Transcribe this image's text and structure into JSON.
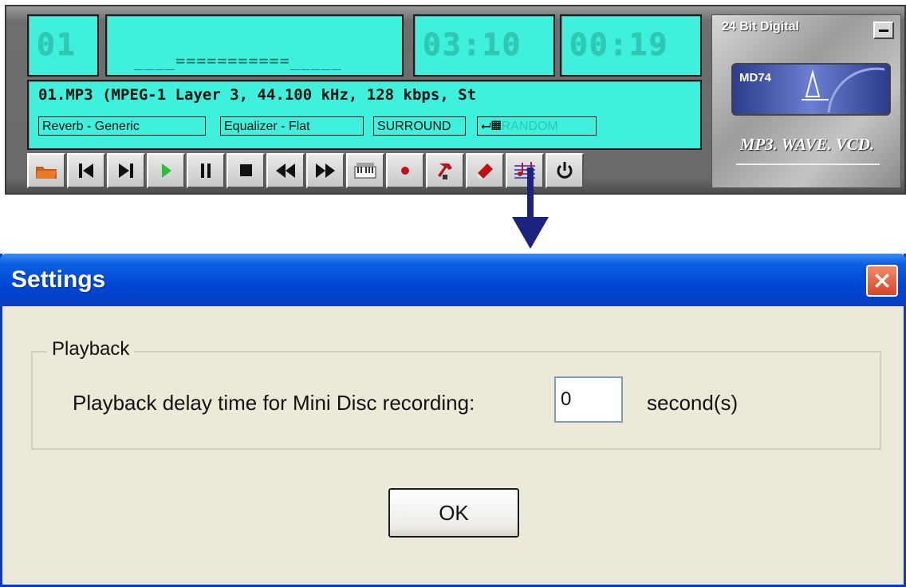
{
  "player": {
    "track_number": "01",
    "spectrum_text": "____===========_____",
    "total_time": "03:10",
    "elapsed_time": "00:19",
    "track_info": "01.MP3 (MPEG-1 Layer 3, 44.100 kHz, 128 kbps, St",
    "reverb": "Reverb - Generic",
    "equalizer": "Equalizer - Flat",
    "surround": "SURROUND",
    "random": "RANDOM",
    "brand_title": "24 Bit Digital",
    "md_label": "MD74",
    "brand_subtitle": "MP3. WAVE. VCD.",
    "buttons": [
      {
        "name": "open-button",
        "icon": "folder-icon"
      },
      {
        "name": "previous-button",
        "icon": "skip-back-icon"
      },
      {
        "name": "next-button",
        "icon": "skip-forward-icon"
      },
      {
        "name": "play-button",
        "icon": "play-icon"
      },
      {
        "name": "pause-button",
        "icon": "pause-icon"
      },
      {
        "name": "stop-button",
        "icon": "stop-icon"
      },
      {
        "name": "rewind-button",
        "icon": "rewind-icon"
      },
      {
        "name": "fast-forward-button",
        "icon": "fast-forward-icon"
      },
      {
        "name": "playlist-button",
        "icon": "piano-icon"
      },
      {
        "name": "record-button",
        "icon": "record-icon"
      },
      {
        "name": "settings-button",
        "icon": "hammer-icon"
      },
      {
        "name": "help-button",
        "icon": "book-icon"
      },
      {
        "name": "music-button",
        "icon": "sheet-music-icon"
      },
      {
        "name": "power-button",
        "icon": "power-icon"
      }
    ]
  },
  "dialog": {
    "title": "Settings",
    "group_label": "Playback",
    "delay_label": "Playback delay time for Mini Disc recording:",
    "delay_value": "0",
    "unit_label": "second(s)",
    "ok_label": "OK"
  },
  "colors": {
    "lcd": "#3ff0dc",
    "titlebar": "#0046d5",
    "arrow": "#1a237e"
  }
}
